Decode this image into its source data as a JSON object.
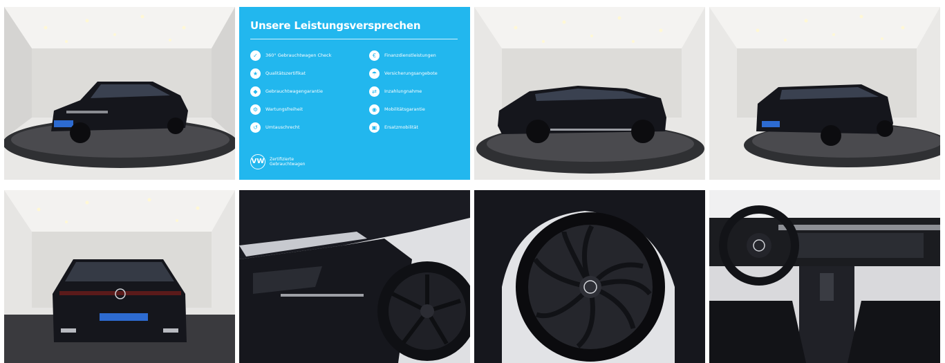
{
  "promo": {
    "title": "Unsere Leistungsversprechen",
    "items_left": [
      {
        "label": "360° Gebrauchtwagen Check",
        "icon": "check-icon"
      },
      {
        "label": "Qualitätszertifikat",
        "icon": "certificate-icon"
      },
      {
        "label": "Gebrauchtwagengarantie",
        "icon": "shield-icon"
      },
      {
        "label": "Wartungsfreiheit",
        "icon": "wrench-icon"
      },
      {
        "label": "Umtauschrecht",
        "icon": "exchange-icon"
      }
    ],
    "items_right": [
      {
        "label": "Finanzdienstleistungen",
        "icon": "finance-icon"
      },
      {
        "label": "Versicherungsangebote",
        "icon": "insurance-icon"
      },
      {
        "label": "Inzahlungnahme",
        "icon": "trade-in-icon"
      },
      {
        "label": "Mobilitätsgarantie",
        "icon": "mobility-icon"
      },
      {
        "label": "Ersatzmobilität",
        "icon": "replacement-car-icon"
      }
    ],
    "badge_line1": "Zertifizierte",
    "badge_line2": "Gebrauchtwagen",
    "logo_text": "VW"
  },
  "colors": {
    "promo_bg": "#22b7ee",
    "car_body": "#15161c",
    "showroom_floor": "#3b3b40"
  }
}
